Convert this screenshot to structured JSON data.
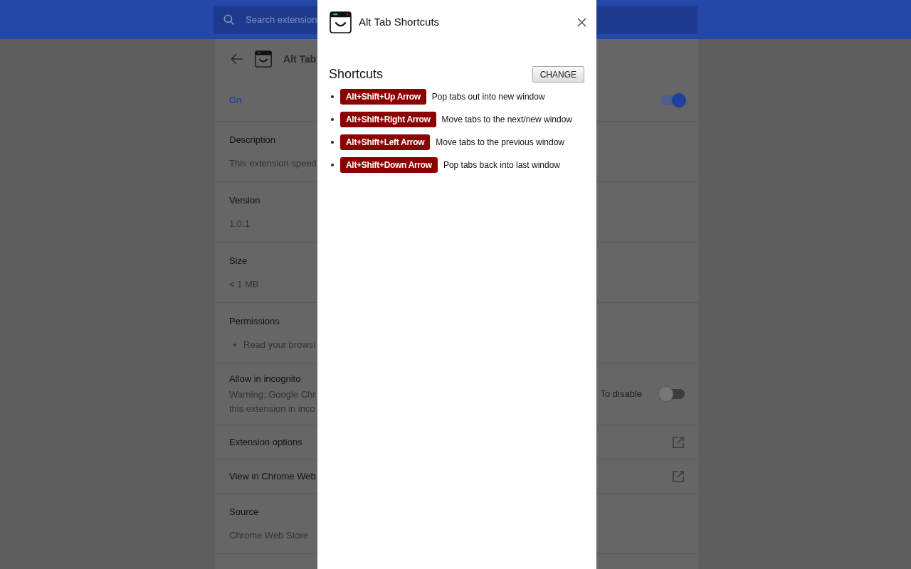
{
  "header": {
    "search_placeholder": "Search extension"
  },
  "details": {
    "name": "Alt Tab",
    "state_label": "On",
    "enabled": true,
    "sections": [
      {
        "kind": "field",
        "label": "Description",
        "value": "This extension speed"
      },
      {
        "kind": "field",
        "label": "Version",
        "value": "1.0.1"
      },
      {
        "kind": "field",
        "label": "Size",
        "value": "< 1 MB"
      },
      {
        "kind": "list",
        "label": "Permissions",
        "items": [
          "Read your browsi"
        ]
      },
      {
        "kind": "toggle",
        "label": "Allow in incognito",
        "lines": [
          "Warning: Google Chr",
          "this extension in inco"
        ],
        "right_text": "To disable",
        "on": false
      },
      {
        "kind": "link",
        "label": "Extension options"
      },
      {
        "kind": "link",
        "label": "View in Chrome Web"
      },
      {
        "kind": "field",
        "label": "Source",
        "value": "Chrome Web Store"
      }
    ]
  },
  "dialog": {
    "title": "Alt Tab Shortcuts",
    "heading": "Shortcuts",
    "button": "CHANGE",
    "shortcuts": [
      {
        "keys": "Alt+Shift+Up Arrow",
        "description": "Pop tabs out into new window"
      },
      {
        "keys": "Alt+Shift+Right Arrow",
        "description": "Move tabs to the next/new window"
      },
      {
        "keys": "Alt+Shift+Left Arrow",
        "description": "Move tabs to the previous window"
      },
      {
        "keys": "Alt+Shift+Down Arrow",
        "description": "Pop tabs back into last window"
      }
    ]
  }
}
